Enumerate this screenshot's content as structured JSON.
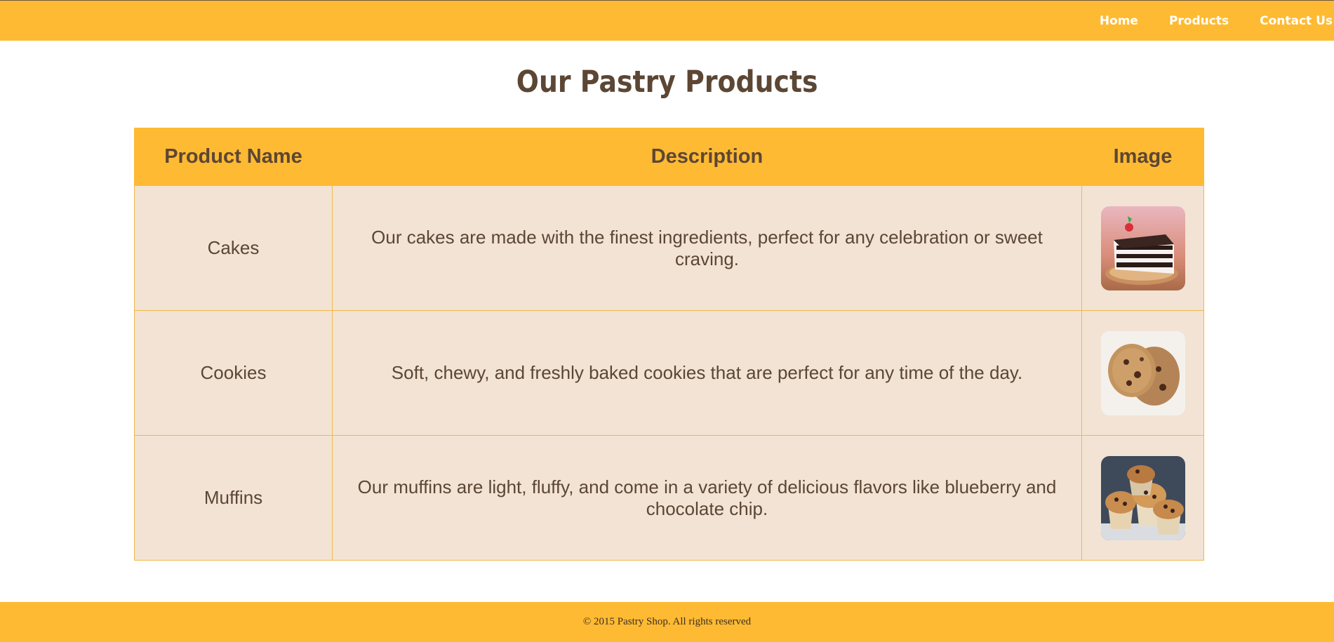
{
  "nav": {
    "items": [
      {
        "label": "Home"
      },
      {
        "label": "Products"
      },
      {
        "label": "Contact Us"
      }
    ]
  },
  "page": {
    "title": "Our Pastry Products"
  },
  "table": {
    "headers": [
      "Product Name",
      "Description",
      "Image"
    ],
    "rows": [
      {
        "name": "Cakes",
        "description": "Our cakes are made with the finest ingredients, perfect for any celebration or sweet craving.",
        "image": "cake-slice-photo"
      },
      {
        "name": "Cookies",
        "description": "Soft, chewy, and freshly baked cookies that are perfect for any time of the day.",
        "image": "cookies-photo"
      },
      {
        "name": "Muffins",
        "description": "Our muffins are light, fluffy, and come in a variety of delicious flavors like blueberry and chocolate chip.",
        "image": "muffins-photo"
      }
    ]
  },
  "footer": {
    "text": "© 2015 Pastry Shop. All rights reserved"
  },
  "colors": {
    "accent": "#FFBA33",
    "text": "#5C4634",
    "row_bg": "#F2E3D5"
  }
}
